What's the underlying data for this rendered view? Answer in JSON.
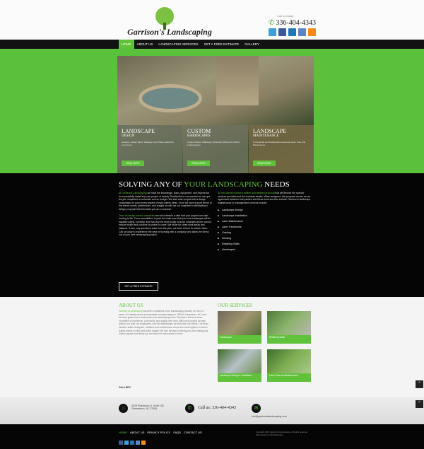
{
  "header": {
    "logo_text": "Garrison's Landscaping",
    "phone_label": "Call us today",
    "phone": "336-404-4343",
    "social": [
      {
        "icon": "twitter-icon",
        "color": "#3c9fd6"
      },
      {
        "icon": "facebook-icon",
        "color": "#3b5a9a"
      },
      {
        "icon": "linkedin-icon",
        "color": "#1f78b4"
      },
      {
        "icon": "google-plus-icon",
        "color": "#5a86c6"
      },
      {
        "icon": "rss-icon",
        "color": "#f08a24"
      }
    ]
  },
  "nav": {
    "items": [
      "HOME",
      "ABOUT US",
      "LANDSCAPING SERVICES",
      "GET A FREE ESTIMATE",
      "GALLERY"
    ]
  },
  "hero": {
    "panels": [
      {
        "title": "LANDSCAPE",
        "subtitle": "DESIGN",
        "text": "Gardens, Flower Beds, Walkways and Patios tailored to your home.",
        "button": "READ MORE"
      },
      {
        "title": "CUSTOM",
        "subtitle": "HARDSCAPES",
        "text": "Custom Patios, Walkways, Retaining Walls and Outdoor Living Spaces.",
        "button": "READ MORE"
      },
      {
        "title": "LANDSCAPE",
        "subtitle": "MAINTENANCE",
        "text": "Commercial and Residential Landscape Lawn Care and Maintenance.",
        "button": "READ MORE"
      }
    ]
  },
  "solving": {
    "title_start": "SOLVING ANY OF ",
    "title_accent": "YOUR LANDSCAPING",
    "title_end": " NEEDS",
    "left_para1_accent": "At Garrison's Landscaping",
    "left_para1": " we have the knowledge, team, equipment, and experience to successfully install any size project of beauty. Residential or commercial we can get the job completed on schedule and on budget. We start each project with a design consultation to cover every aspect of each clients ideas. Once we have a good sense of the clients needs, preferences, and budget we will use our expertise in developing a design proposal that best suits you as a customer.",
    "left_para2_accent": "Once all design work is completed",
    "left_para2": " we will schedule a date that your project can start coming to life. From consultation to plan we make sure that your new landscape will be installed safely, correctly, and that only the best locally sourced materials will be used to ensure health and success for years to come. We strive for clean work areas and balance. If ever, any questions arise from the plan, our team is here to answer them. Call us today to experience the ease of working with a company who takes the stress out of your next landscaping project.",
    "right_para_accent": "All new clients receive a written and detailed proposal",
    "right_para": " that will itemize the specific services provided and the business details. When assigned, this proposal serves as our agreement between both parties and these work services include: Garrison's landscape maintenance or management services include:",
    "list": [
      "Landscape Design",
      "Landscape Installation",
      "Lawn Maintenance",
      "Lawn Treatments",
      "Grading",
      "Seeding",
      "Retaining Walls",
      "Hardscapes"
    ],
    "button": "GET A FREE ESTIMATE"
  },
  "about": {
    "title": "ABOUT US",
    "text_accent": "Garrison's Landscaping",
    "text": " has been in business in the Landscaping Industry for over 15 years. Our family owned and operated company began in 1999 in Greensboro, NC, and we have grown into a trusted name for landscaping in the Triad area. We have been committed to excellence, community, and quality ever since. With every project we take pride in our craft, our employees, and the relationships we build with our clients. Our team includes skilled designers, installers and maintenance crews who work together to deliver quality results on time and within budget. We look forward to serving you and making your outdoor space something you can enjoy for many years to come.",
    "gallery_label": "GALLERY"
  },
  "services": {
    "title": "OUR SERVICES",
    "items": [
      {
        "label": "Hardscapes",
        "colors": [
          "#6f6a5a",
          "#a0956f",
          "#556b3a"
        ]
      },
      {
        "label": "Retaining Walls",
        "colors": [
          "#4e7a3a",
          "#8bb36b",
          "#b8b8b0"
        ]
      },
      {
        "label": "Landscape Design & Installation",
        "colors": [
          "#3f6b2a",
          "#b6c0c6",
          "#6d8f4f"
        ]
      },
      {
        "label": "Lawn Care and Maintenance",
        "colors": [
          "#3c6e2c",
          "#7fae52",
          "#a9c98a"
        ]
      }
    ]
  },
  "contact": {
    "address_line1": "4008 Pinebrook Ct, Suite 100",
    "address_line2": "Greensboro, NC 27409",
    "call_text": "Call us: 336-404-4343",
    "email": "info@garrisonslandscaping.com"
  },
  "footer": {
    "links": [
      "HOME",
      "ABOUT US",
      "PRIVACY POLICY",
      "FAQS",
      "CONTACT US"
    ],
    "copyright": "Copyright 2015 Garrison's Landscaping. All rights reserved. Web design by Click Marketing",
    "social_colors": [
      "#3b5a9a",
      "#3c9fd6",
      "#1f78b4",
      "#5a86c6",
      "#f08a24"
    ]
  },
  "colors": {
    "accent": "#5fc23a",
    "dark": "#050505"
  }
}
